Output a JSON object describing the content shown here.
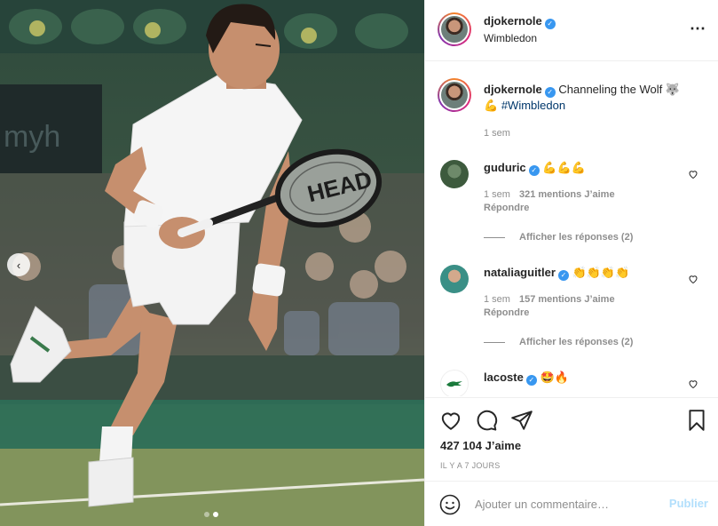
{
  "post": {
    "author": "djokernole",
    "location": "Wimbledon",
    "more_icon": "more-horizontal-icon",
    "caption_text": "Channeling the Wolf 🐺",
    "caption_emoji": "💪",
    "caption_hashtag": "#Wimbledon",
    "caption_time": "1 sem",
    "likes": "427 104 J’aime",
    "timestamp": "IL Y A 7 JOURS",
    "carousel_prev": "‹"
  },
  "comments": [
    {
      "user": "guduric",
      "text": "💪💪💪",
      "time": "1 sem",
      "likes": "321 mentions J’aime",
      "reply": "Répondre",
      "view_replies": "Afficher les réponses (2)"
    },
    {
      "user": "nataliaguitler",
      "text": "👏👏👏👏",
      "time": "1 sem",
      "likes": "157 mentions J’aime",
      "reply": "Répondre",
      "view_replies": "Afficher les réponses (2)"
    },
    {
      "user": "lacoste",
      "text": "🤩🔥"
    }
  ],
  "comment_box": {
    "placeholder": "Ajouter un commentaire…",
    "publish": "Publier"
  },
  "colors": {
    "verified": "#3897f0",
    "hashtag": "#00376b",
    "publish_disabled": "#b2dffc",
    "secondary_text": "#8e8e8e"
  }
}
